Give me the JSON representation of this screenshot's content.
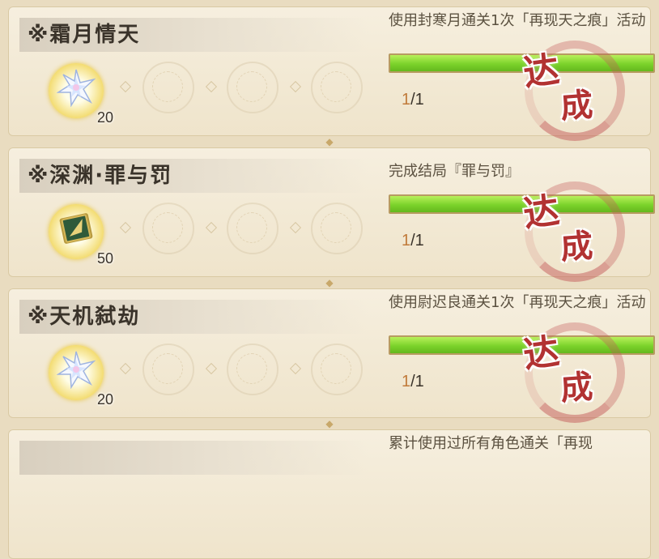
{
  "achievements": [
    {
      "title": "※霜月情天",
      "description": "使用封寒月通关1次「再现天之痕」活动",
      "reward": {
        "icon": "crystal-star-icon",
        "quantity": "20"
      },
      "progress": {
        "current": "1",
        "total": "/1",
        "fraction": 1.0
      },
      "stamp": [
        "达",
        "成"
      ]
    },
    {
      "title": "※深渊·罪与罚",
      "description": "完成结局『罪与罚』",
      "reward": {
        "icon": "green-tome-icon",
        "quantity": "50"
      },
      "progress": {
        "current": "1",
        "total": "/1",
        "fraction": 1.0
      },
      "stamp": [
        "达",
        "成"
      ]
    },
    {
      "title": "※天机弑劫",
      "description": "使用尉迟良通关1次「再现天之痕」活动",
      "reward": {
        "icon": "crystal-star-icon",
        "quantity": "20"
      },
      "progress": {
        "current": "1",
        "total": "/1",
        "fraction": 1.0
      },
      "stamp": [
        "达",
        "成"
      ]
    },
    {
      "title": "",
      "description": "累计使用过所有角色通关「再现"
    }
  ],
  "colors": {
    "progress_fill": "#7bd22b",
    "stamp": "#b23232",
    "count_current": "#c07a3a"
  }
}
